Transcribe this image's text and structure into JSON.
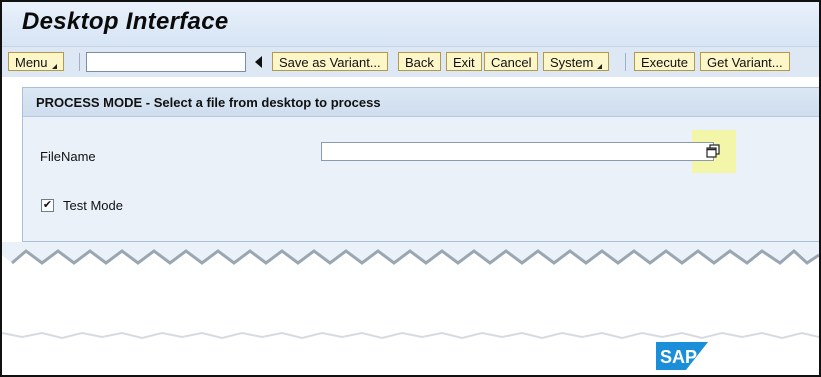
{
  "window": {
    "title": "Desktop Interface"
  },
  "toolbar": {
    "menu_label": "Menu",
    "command_value": "",
    "save_variant_label": "Save as Variant...",
    "back_label": "Back",
    "exit_label": "Exit",
    "cancel_label": "Cancel",
    "system_label": "System",
    "execute_label": "Execute",
    "get_variant_label": "Get Variant..."
  },
  "panel": {
    "title": "PROCESS MODE - Select a file from desktop to process",
    "filename_label": "FileName",
    "filename_value": "",
    "test_mode_label": "Test Mode",
    "test_mode_checked": true
  },
  "logo": {
    "text": "SAP",
    "color": "#1a8ed8"
  },
  "icons": {
    "browse": "browse-file-icon"
  },
  "colors": {
    "button_bg": "#fdf6c8",
    "highlight": "#f5f79a"
  }
}
